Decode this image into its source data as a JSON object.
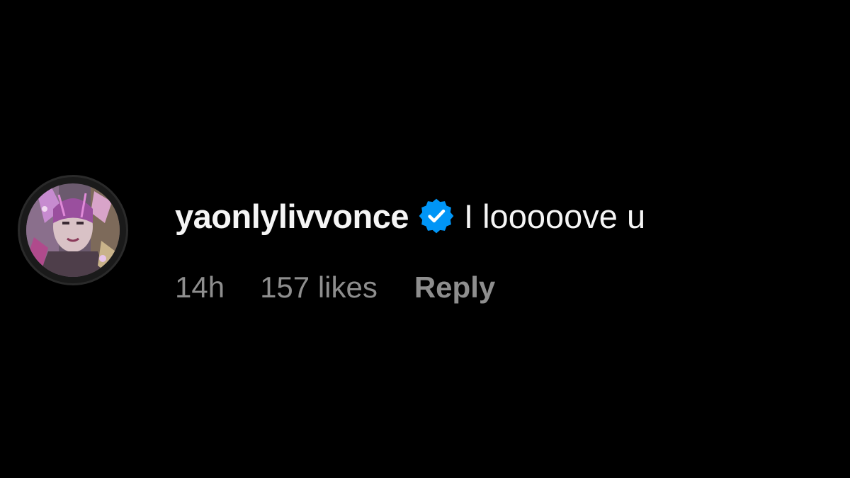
{
  "comment": {
    "username": "yaonlylivvonce",
    "text": "I looooove u",
    "verified_icon": "verified-badge-icon",
    "timestamp": "14h",
    "likes": "157 likes",
    "reply_label": "Reply",
    "avatar_icon": "profile-avatar"
  },
  "colors": {
    "background": "#000000",
    "primary_text": "#f5f5f5",
    "secondary_text": "#8e8e8e",
    "verified_blue": "#0095f6"
  }
}
